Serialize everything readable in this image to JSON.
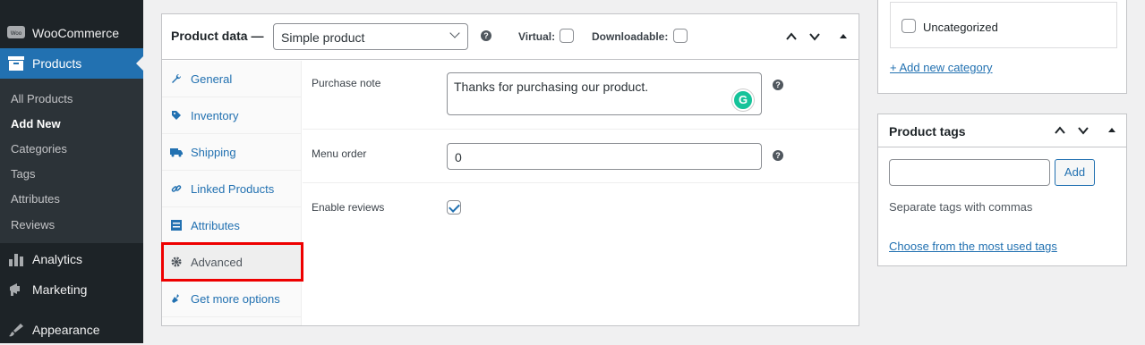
{
  "sidebar": {
    "woocommerce": "WooCommerce",
    "products": "Products",
    "submenu": [
      "All Products",
      "Add New",
      "Categories",
      "Tags",
      "Attributes",
      "Reviews"
    ],
    "analytics": "Analytics",
    "marketing": "Marketing",
    "appearance": "Appearance",
    "woo_badge": "Woo"
  },
  "product_data": {
    "title": "Product data —",
    "type_select": "Simple product",
    "virtual_label": "Virtual:",
    "downloadable_label": "Downloadable:",
    "tabs": [
      "General",
      "Inventory",
      "Shipping",
      "Linked Products",
      "Attributes",
      "Advanced",
      "Get more options"
    ],
    "selected_tab": "Advanced",
    "purchase_note_label": "Purchase note",
    "purchase_note_value": "Thanks for purchasing our product.",
    "menu_order_label": "Menu order",
    "menu_order_value": "0",
    "enable_reviews_label": "Enable reviews",
    "grammarly": "G",
    "help": "?"
  },
  "categories": {
    "uncategorized": "Uncategorized",
    "add_new": "+ Add new category"
  },
  "tags": {
    "title": "Product tags",
    "add_button": "Add",
    "hint": "Separate tags with commas",
    "most_used_link": "Choose from the most used tags"
  },
  "colors": {
    "accent": "#2271b1",
    "sidebar": "#1d2327",
    "highlight": "#e00000"
  }
}
